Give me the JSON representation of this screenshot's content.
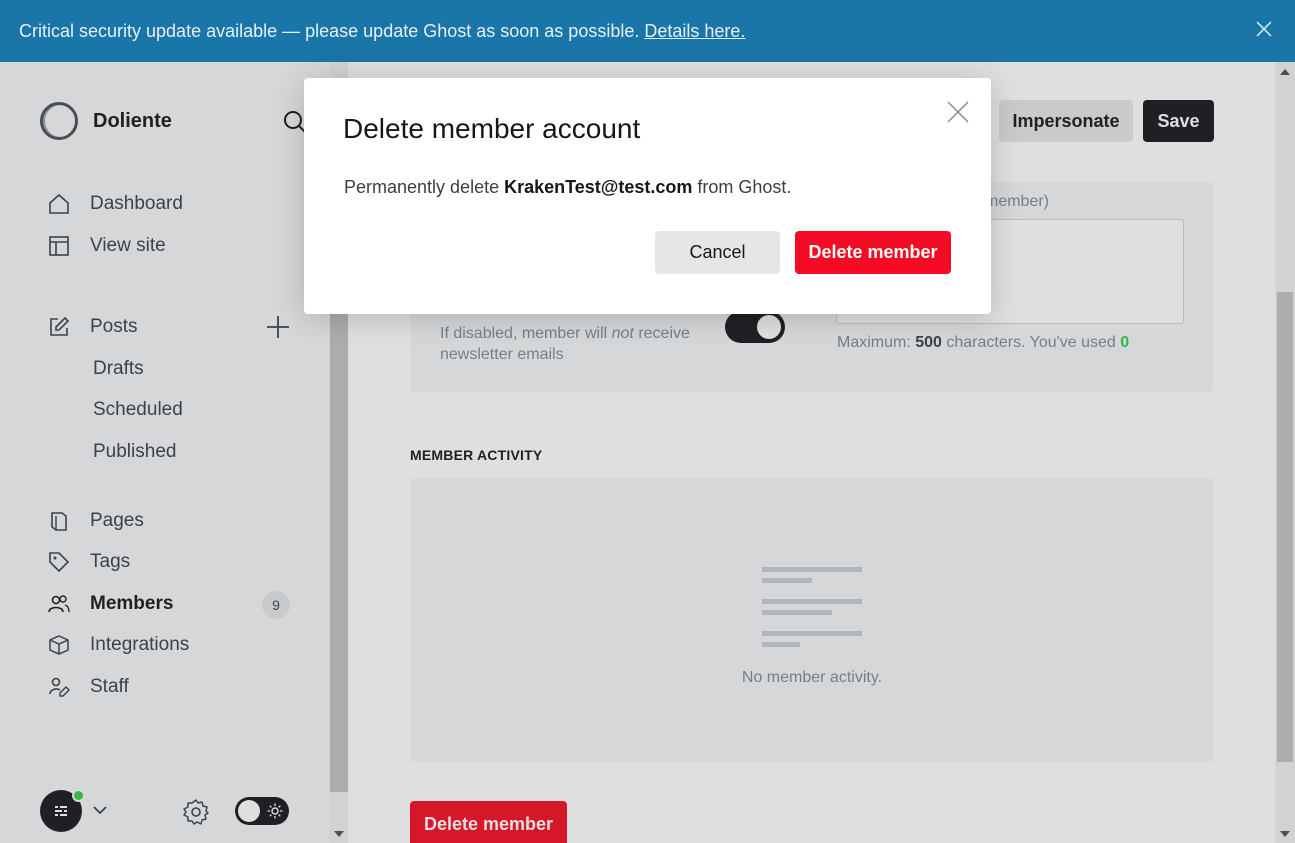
{
  "banner": {
    "message": "Critical security update available — please update Ghost as soon as possible.",
    "link_text": "Details here."
  },
  "sidebar": {
    "site_name": "Doliente",
    "items": [
      {
        "label": "Dashboard",
        "icon": "house-icon"
      },
      {
        "label": "View site",
        "icon": "layout-icon"
      },
      {
        "label": "Posts",
        "icon": "pencil-icon"
      },
      {
        "label": "Pages",
        "icon": "page-icon"
      },
      {
        "label": "Tags",
        "icon": "tag-icon"
      },
      {
        "label": "Members",
        "icon": "members-icon",
        "count": "9"
      },
      {
        "label": "Integrations",
        "icon": "cube-icon"
      },
      {
        "label": "Staff",
        "icon": "staff-icon"
      }
    ],
    "post_sub_items": [
      "Drafts",
      "Scheduled",
      "Published"
    ]
  },
  "header": {
    "impersonate_label": "Impersonate",
    "save_label": "Save"
  },
  "member_settings": {
    "note_label": "member)",
    "note_help_prefix": "Maximum: ",
    "note_max": "500",
    "note_help_mid": " characters. You've used ",
    "note_used": "0",
    "newsletter_help_1": "If disabled, member will ",
    "newsletter_help_em": "not",
    "newsletter_help_2": " receive newsletter emails",
    "newsletter_enabled": true
  },
  "activity": {
    "heading": "MEMBER ACTIVITY",
    "empty_text": "No member activity."
  },
  "footer": {
    "delete_label": "Delete member"
  },
  "modal": {
    "title": "Delete member account",
    "body_prefix": "Permanently delete ",
    "email": "KrakenTest@test.com",
    "body_suffix": " from Ghost.",
    "cancel_label": "Cancel",
    "delete_label": "Delete member"
  },
  "colors": {
    "banner": "#1a75a8",
    "danger": "#f50b23",
    "dark": "#15171a",
    "success": "#30cf43"
  }
}
